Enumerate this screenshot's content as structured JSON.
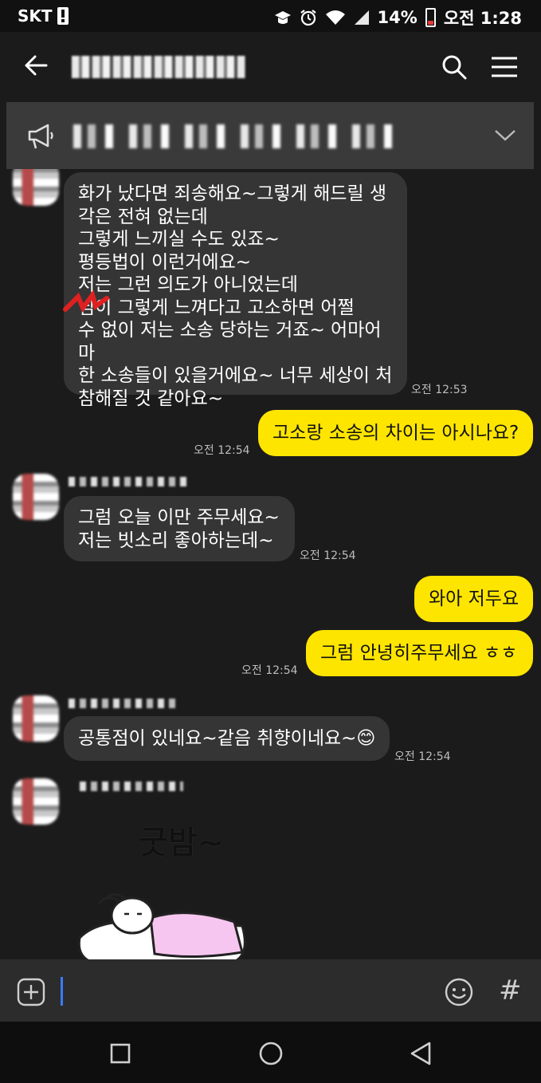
{
  "status_bar": {
    "carrier": "SKT",
    "battery": "14%",
    "time": "오전 1:28"
  },
  "header": {
    "title_blurred": true
  },
  "notice": {
    "icon": "megaphone-icon",
    "text_blurred": true
  },
  "messages": [
    {
      "id": "m1",
      "side": "in",
      "text": "화가 났다면 죄송해요~그렇게 해드릴 생\n각은 전혀 없는데\n그렇게 느끼실 수도 있죠~\n평등법이 이런거에요~\n저는 그런 의도가 아니었는데\n님이 그렇게 느껴다고 고소하면 어쩔\n수 없이 저는 소송 당하는 거죠~ 어마어마\n한 소송들이 있을거에요~ 너무 세상이 처\n참해질 것 같아요~",
      "time": "오전 12:53"
    },
    {
      "id": "m2",
      "side": "out",
      "text": "고소랑 소송의 차이는 아시나요?",
      "time": "오전 12:54"
    },
    {
      "id": "m3",
      "side": "in",
      "text": "그럼 오늘 이만 주무세요~\n저는 빗소리 좋아하는데~",
      "time": "오전 12:54"
    },
    {
      "id": "m4",
      "side": "out",
      "text": "와아 저두요"
    },
    {
      "id": "m5",
      "side": "out",
      "text": "그럼 안녕히주무세요 ㅎㅎ",
      "time": "오전 12:54"
    },
    {
      "id": "m6",
      "side": "in",
      "text": "공통점이 있네요~같음 취향이네요~😊",
      "time": "오전 12:54"
    },
    {
      "id": "m7",
      "side": "in",
      "sticker_text": "굿밤~",
      "sticker": "sleeping-bunny-sticker"
    }
  ],
  "input_bar": {
    "attach_icon": "plus-square-icon",
    "emoji_icon": "emoji-icon",
    "hashtag_label": "#"
  },
  "colors": {
    "my_bubble": "#fee500",
    "their_bubble": "#353535",
    "background": "#1b1b1b"
  }
}
